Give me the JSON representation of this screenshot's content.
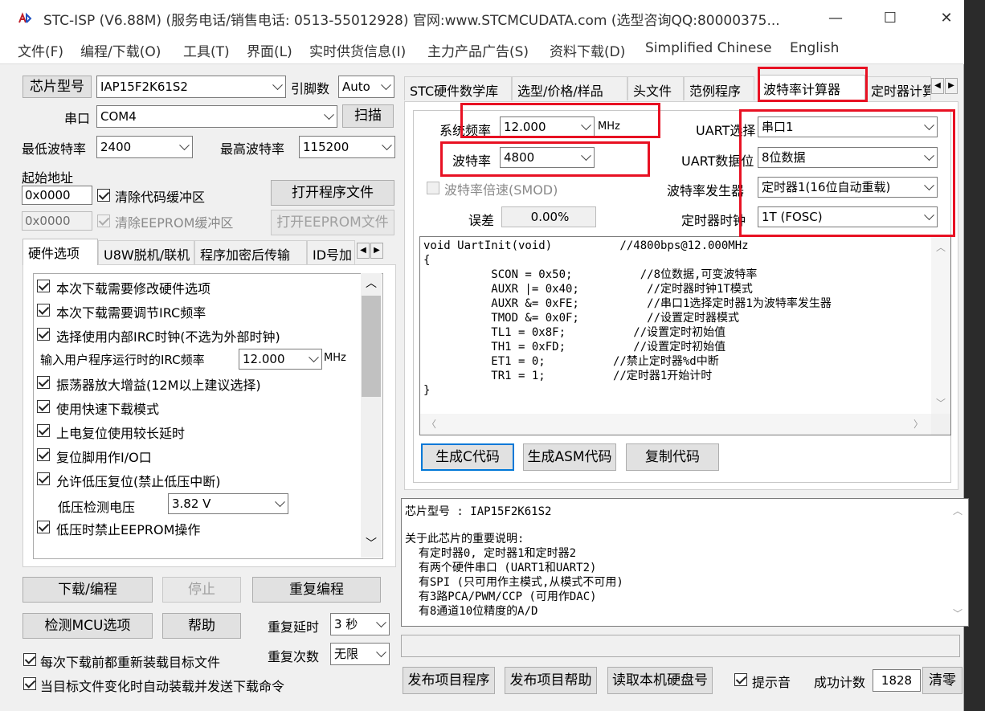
{
  "window": {
    "title": "STC-ISP (V6.88M) (服务电话/销售电话: 0513-55012928) 官网:www.STCMCUDATA.com  (选型咨询QQ:80000375...",
    "minimize": "—",
    "maximize": "☐",
    "close": "✕"
  },
  "menu": [
    "文件(F)",
    "编程/下载(O)",
    "工具(T)",
    "界面(L)",
    "实时供货信息(I)",
    "主力产品广告(S)",
    "资料下载(D)",
    "Simplified Chinese",
    "English"
  ],
  "left": {
    "chip_label": "芯片型号",
    "chip_value": "IAP15F2K61S2",
    "pin_label": "引脚数",
    "pin_value": "Auto",
    "port_label": "串口",
    "port_value": "COM4",
    "scan_btn": "扫描",
    "min_baud_label": "最低波特率",
    "min_baud_value": "2400",
    "max_baud_label": "最高波特率",
    "max_baud_value": "115200",
    "start_addr_label": "起始地址",
    "addr1": "0x0000",
    "clear_code": "清除代码缓冲区",
    "open_prog": "打开程序文件",
    "addr2": "0x0000",
    "clear_eeprom": "清除EEPROM缓冲区",
    "open_eeprom": "打开EEPROM文件",
    "tabs": [
      "硬件选项",
      "U8W脱机/联机",
      "程序加密后传输",
      "ID号加"
    ],
    "options": [
      "本次下载需要修改硬件选项",
      "本次下载需要调节IRC频率",
      "选择使用内部IRC时钟(不选为外部时钟)"
    ],
    "irc_label": "输入用户程序运行时的IRC频率",
    "irc_value": "12.000",
    "irc_unit": "MHz",
    "options2": [
      "振荡器放大增益(12M以上建议选择)",
      "使用快速下载模式",
      "上电复位使用较长延时",
      "复位脚用作I/O口",
      "允许低压复位(禁止低压中断)"
    ],
    "lv_label": "低压检测电压",
    "lv_value": "3.82 V",
    "lv_eeprom": "低压时禁止EEPROM操作",
    "btn_download": "下载/编程",
    "btn_stop": "停止",
    "btn_reprog": "重复编程",
    "btn_detect": "检测MCU选项",
    "btn_help": "帮助",
    "delay_label": "重复延时",
    "delay_value": "3 秒",
    "count_label": "重复次数",
    "count_value": "无限",
    "reload_each": "每次下载前都重新装载目标文件",
    "auto_reload": "当目标文件变化时自动装载并发送下载命令"
  },
  "right": {
    "tabs": [
      "STC硬件数学库",
      "选型/价格/样品",
      "头文件",
      "范例程序",
      "波特率计算器",
      "定时器计算"
    ],
    "sysfreq_label": "系统频率",
    "sysfreq_value": "12.000",
    "sysfreq_unit": "MHz",
    "baud_label": "波特率",
    "baud_value": "4800",
    "smod_label": "波特率倍速(SMOD)",
    "error_label": "误差",
    "error_value": "0.00%",
    "uart_sel_label": "UART选择",
    "uart_sel_value": "串口1",
    "uart_bits_label": "UART数据位",
    "uart_bits_value": "8位数据",
    "gen_label": "波特率发生器",
    "gen_value": "定时器1(16位自动重载)",
    "clk_label": "定时器时钟",
    "clk_value": "1T  (FOSC)",
    "code_lines": [
      "void UartInit(void)\t\t//4800bps@12.000MHz",
      "{",
      "\tSCON = 0x50;\t\t//8位数据,可变波特率",
      "\tAUXR |= 0x40;\t\t//定时器时钟1T模式",
      "\tAUXR &= 0xFE;\t\t//串口1选择定时器1为波特率发生器",
      "\tTMOD &= 0x0F;\t\t//设置定时器模式",
      "\tTL1 = 0x8F;\t\t//设置定时初始值",
      "\tTH1 = 0xFD;\t\t//设置定时初始值",
      "\tET1 = 0;\t\t//禁止定时器%d中断",
      "\tTR1 = 1;\t\t//定时器1开始计时",
      "}"
    ],
    "btn_c": "生成C代码",
    "btn_asm": "生成ASM代码",
    "btn_copy": "复制代码",
    "info_lines": [
      "芯片型号 : IAP15F2K61S2",
      "",
      "关于此芯片的重要说明:",
      "  有定时器0, 定时器1和定时器2",
      "  有两个硬件串口 (UART1和UART2)",
      "  有SPI (只可用作主模式,从模式不可用)",
      "  有3路PCA/PWM/CCP (可用作DAC)",
      "  有8通道10位精度的A/D"
    ],
    "btn_publish": "发布项目程序",
    "btn_publish_help": "发布项目帮助",
    "btn_read_disk": "读取本机硬盘号",
    "beep": "提示音",
    "success_label": "成功计数",
    "success_value": "1828",
    "btn_clear": "清零"
  },
  "colors": {
    "highlight": "#e81123",
    "accent": "#0078d7"
  }
}
